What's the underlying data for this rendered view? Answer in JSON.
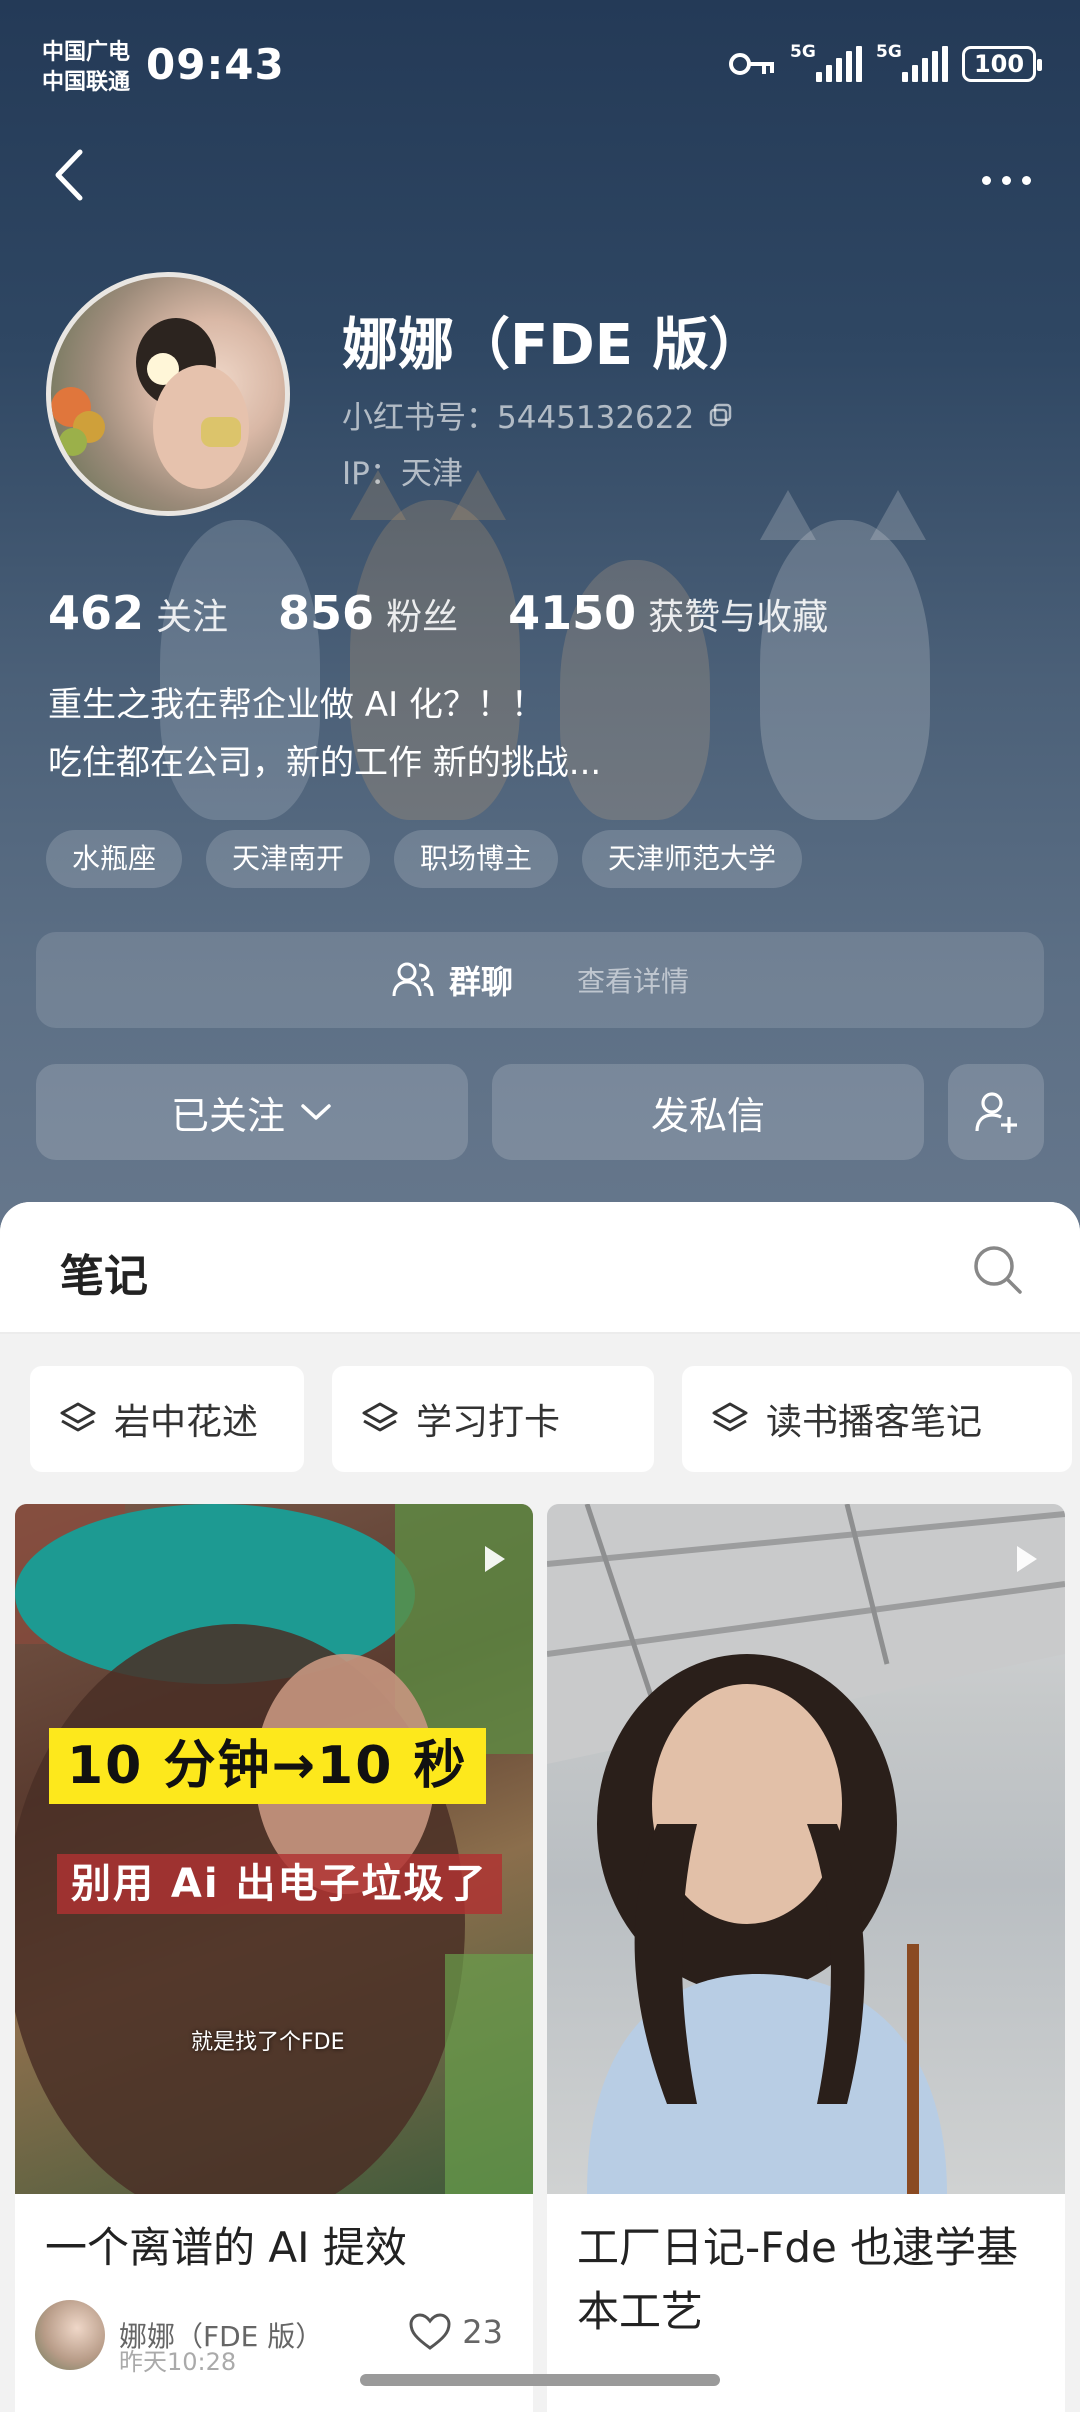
{
  "status_bar": {
    "carrier_1": "中国广电",
    "carrier_2": "中国联通",
    "time": "09:43",
    "signal_1_label": "5G",
    "signal_2_label": "5G",
    "battery": "100"
  },
  "nav": {
    "back_icon": "chevron-left-icon",
    "more_icon": "more-horizontal-icon"
  },
  "profile": {
    "nickname": "娜娜（FDE 版）",
    "xhs_id": "小红书号：5445132622",
    "ip": "IP：天津",
    "stats": [
      {
        "num": "462",
        "label": "关注"
      },
      {
        "num": "856",
        "label": "粉丝"
      },
      {
        "num": "4150",
        "label": "获赞与收藏"
      }
    ],
    "bio_line_1": "重生之我在帮企业做 AI 化？！！",
    "bio_line_2": "吃住都在公司，新的工作 新的挑战...",
    "tags": [
      "水瓶座",
      "天津南开",
      "职场博主",
      "天津师范大学"
    ]
  },
  "group_chat": {
    "label": "群聊",
    "detail": "查看详情"
  },
  "actions": {
    "following": "已关注",
    "message": "发私信"
  },
  "notes_section": {
    "title": "笔记",
    "collections": [
      "岩中花述",
      "学习打卡",
      "读书播客笔记"
    ]
  },
  "notes": [
    {
      "title": "一个离谱的 AI 提效",
      "overlay_main": "10 分钟→10 秒",
      "overlay_sub": "别用 Ai 出电子垃圾了",
      "subtitle": "就是找了个FDE",
      "author": "娜娜（FDE 版）",
      "time": "昨天10:28",
      "likes": "23"
    },
    {
      "title": "工厂日记-Fde 也逮学基本工艺"
    }
  ],
  "colors": {
    "accent": "#fde81c",
    "hero_top": "#243a57",
    "hero_bottom": "#66778c"
  }
}
